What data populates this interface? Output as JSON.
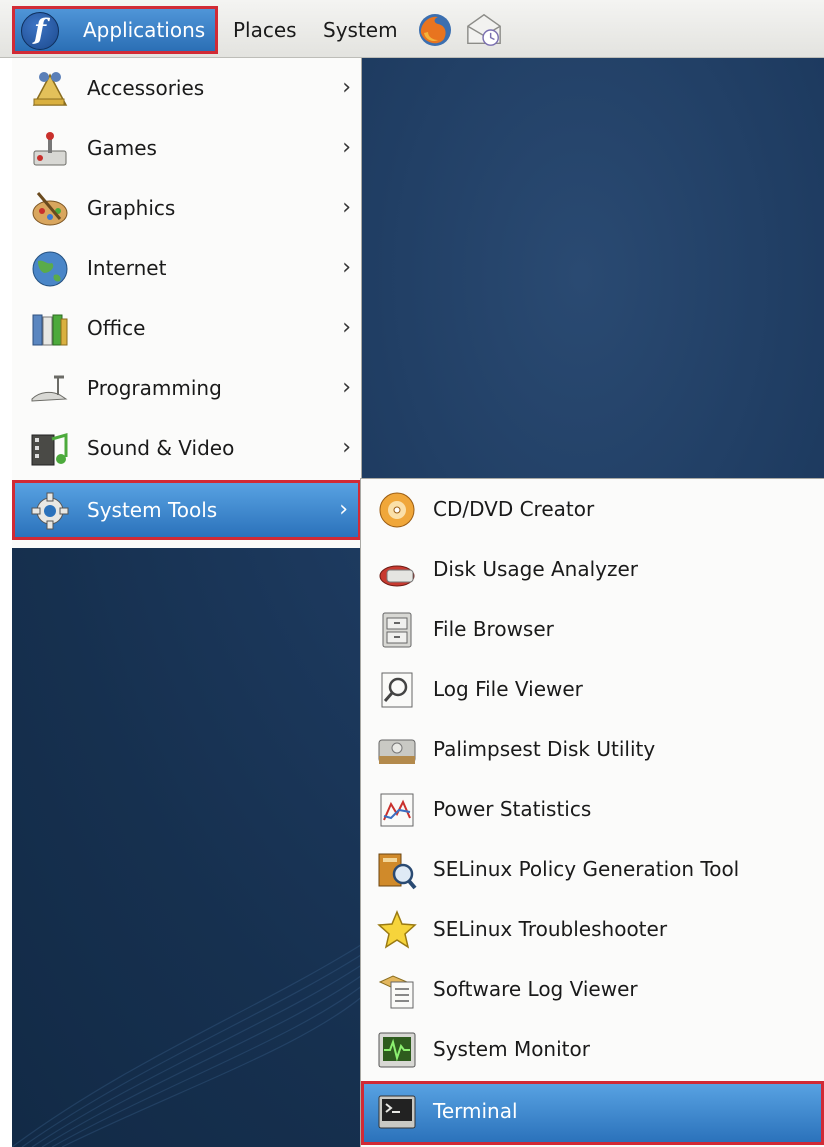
{
  "panel": {
    "applications_label": "Applications",
    "places_label": "Places",
    "system_label": "System",
    "icons": [
      "fedora-logo-icon",
      "firefox-icon",
      "mail-notification-icon"
    ]
  },
  "applications_menu": {
    "items": [
      {
        "label": "Accessories",
        "icon": "accessories-icon",
        "arrow": "›"
      },
      {
        "label": "Games",
        "icon": "games-icon",
        "arrow": "›"
      },
      {
        "label": "Graphics",
        "icon": "graphics-icon",
        "arrow": "›"
      },
      {
        "label": "Internet",
        "icon": "internet-globe-icon",
        "arrow": "›"
      },
      {
        "label": "Office",
        "icon": "office-icon",
        "arrow": "›"
      },
      {
        "label": "Programming",
        "icon": "programming-icon",
        "arrow": "›"
      },
      {
        "label": "Sound & Video",
        "icon": "sound-video-icon",
        "arrow": "›"
      },
      {
        "label": "System Tools",
        "icon": "system-tools-gear-icon",
        "arrow": "›",
        "selected": true
      }
    ]
  },
  "system_tools_menu": {
    "items": [
      {
        "label": "CD/DVD Creator",
        "icon": "cd-dvd-creator-icon"
      },
      {
        "label": "Disk Usage Analyzer",
        "icon": "disk-usage-icon"
      },
      {
        "label": "File Browser",
        "icon": "file-browser-icon"
      },
      {
        "label": "Log File Viewer",
        "icon": "log-file-viewer-icon"
      },
      {
        "label": "Palimpsest Disk Utility",
        "icon": "disk-utility-icon"
      },
      {
        "label": "Power Statistics",
        "icon": "power-statistics-icon"
      },
      {
        "label": "SELinux Policy Generation Tool",
        "icon": "selinux-policy-icon"
      },
      {
        "label": "SELinux Troubleshooter",
        "icon": "selinux-troubleshooter-star-icon"
      },
      {
        "label": "Software Log Viewer",
        "icon": "software-log-viewer-icon"
      },
      {
        "label": "System Monitor",
        "icon": "system-monitor-icon"
      },
      {
        "label": "Terminal",
        "icon": "terminal-icon",
        "selected": true
      }
    ]
  },
  "colors": {
    "highlight": "#2b72bb",
    "annotation_border": "#d12a35",
    "desktop": "#1d3a5f"
  }
}
